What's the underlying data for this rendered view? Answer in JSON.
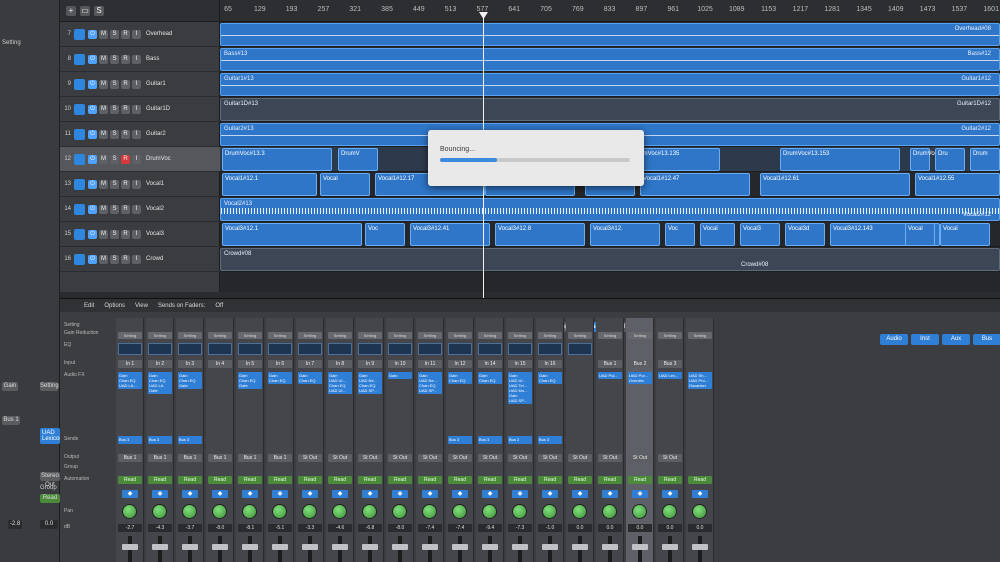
{
  "inspector": {
    "labels": [
      "Setting",
      "Gain",
      "Bus 1",
      "Stereo Out",
      "Group",
      "Read"
    ],
    "plugin": "UAD Lexicon",
    "values": [
      "-2.8",
      "0.0"
    ]
  },
  "toolbar": {
    "add": "+",
    "s": "S"
  },
  "tracks": [
    {
      "num": "7",
      "name": "Overhead"
    },
    {
      "num": "8",
      "name": "Bass"
    },
    {
      "num": "9",
      "name": "Guitar1"
    },
    {
      "num": "10",
      "name": "Guitar1D"
    },
    {
      "num": "11",
      "name": "Guitar2"
    },
    {
      "num": "12",
      "name": "DrumVoc"
    },
    {
      "num": "13",
      "name": "Vocal1"
    },
    {
      "num": "14",
      "name": "Vocal2"
    },
    {
      "num": "15",
      "name": "Vocal3"
    },
    {
      "num": "16",
      "name": "Crowd"
    }
  ],
  "track_buttons": [
    "M",
    "S",
    "R",
    "I"
  ],
  "ruler": [
    "65",
    "129",
    "193",
    "257",
    "321",
    "385",
    "449",
    "513",
    "577",
    "641",
    "705",
    "769",
    "833",
    "897",
    "961",
    "1025",
    "1089",
    "1153",
    "1217",
    "1281",
    "1345",
    "1409",
    "1473",
    "1537",
    "1601"
  ],
  "regions": {
    "overhead": "Overhead#08",
    "bass1": "Bass#13",
    "bass2": "Bass#12",
    "guitar1a": "Guitar1#13",
    "guitar1b": "Guitar1#12",
    "guitar1d_a": "Guitar1D#13",
    "guitar1d_b": "Guitar1D#12",
    "guitar2a": "Guitar2#13",
    "guitar2b": "Guitar2#12",
    "drumvoc": [
      "DrumVoc#13.3",
      "DrumV",
      "DrumVoc#13.135",
      "DrumVoc#13.153",
      "DrumVoc#13.158",
      "Dru",
      "Drum"
    ],
    "vocal1": [
      "Vocal1#12.1",
      "Vocal",
      "Vocal1#12.17",
      "Vocal1#12.21",
      "Vocal1#1",
      "Vocal1#12.47",
      "Vocal1#12.61",
      "Vocal1#12.55"
    ],
    "vocal2a": "Vocal2#13",
    "vocal2b": "Vocal2#12",
    "vocal3": [
      "Vocal3#12.1",
      "Voc",
      "Vocal3#12.41",
      "Vocal3#12.8",
      "Vocal3#12.",
      "Voc",
      "Vocal",
      "Vocal3",
      "Vocal3d",
      "Vocal3#12.143",
      "Vocal",
      "Vocal"
    ],
    "crowd": [
      "Crowd#08",
      "Crowd#08"
    ]
  },
  "bounce": {
    "label": "Bouncing...",
    "progress": 0.3
  },
  "mixer_bar": {
    "edit": "Edit",
    "options": "Options",
    "view": "View",
    "sends_on_faders": "Sends on Faders:",
    "off": "Off"
  },
  "mixer_tabs": [
    "Single",
    "Tracks",
    "All"
  ],
  "filter_tabs": [
    "Audio",
    "Inst",
    "Aux",
    "Bus"
  ],
  "row_labels": [
    "Setting",
    "Gain Reduction",
    "EQ",
    "Input",
    "Audio FX",
    "Sends",
    "Output",
    "Group",
    "Automation",
    "Pan",
    "dB"
  ],
  "strips": [
    {
      "setting": "Setting",
      "input": "In 1",
      "fx": "Gain\nChan EQ\nUAD LA...",
      "send": "Bus 3",
      "out": "Bus 1",
      "auto": "Read",
      "db": "-2.7"
    },
    {
      "setting": "Setting",
      "input": "In 2",
      "fx": "Gain\nChan EQ\nUAD LA\nGate",
      "send": "Bus 3",
      "out": "Bus 1",
      "auto": "Read",
      "db": "-4.3"
    },
    {
      "setting": "Setting",
      "input": "In 3",
      "fx": "Gain\nChan EQ\nGate",
      "send": "Bus 3",
      "out": "Bus 1",
      "auto": "Read",
      "db": "-3.7"
    },
    {
      "setting": "Setting",
      "input": "In 4",
      "fx": "",
      "send": "",
      "out": "Bus 1",
      "auto": "Read",
      "db": "-8.0"
    },
    {
      "setting": "Setting",
      "input": "In 5",
      "fx": "Gain\nChan EQ\nGate",
      "send": "",
      "out": "Bus 1",
      "auto": "Read",
      "db": "-8.1"
    },
    {
      "setting": "Setting",
      "input": "In 6",
      "fx": "Gain\nChan EQ",
      "send": "",
      "out": "Bus 1",
      "auto": "Read",
      "db": "-5.1"
    },
    {
      "setting": "Setting",
      "input": "In 7",
      "fx": "Gain\nChan EQ",
      "send": "",
      "out": "St Out",
      "auto": "Read",
      "db": "-3.3"
    },
    {
      "setting": "Setting",
      "input": "In 8",
      "fx": "Gain\nUAD Ul...\nChan EQ\nUAD Ul...",
      "send": "",
      "out": "St Out",
      "auto": "Read",
      "db": "-4.6"
    },
    {
      "setting": "Setting",
      "input": "In 9",
      "fx": "Gain\nUAD Ne...\nChan EQ\nUAD SP...",
      "send": "",
      "out": "St Out",
      "auto": "Read",
      "db": "-6.8"
    },
    {
      "setting": "Setting",
      "input": "In 10",
      "fx": "Gain",
      "send": "",
      "out": "St Out",
      "auto": "Read",
      "db": "-8.0"
    },
    {
      "setting": "Setting",
      "input": "In 11",
      "fx": "Gain\nUAD Ne...\nChan EQ\nUAD SP...",
      "send": "",
      "out": "St Out",
      "auto": "Read",
      "db": "-7.4"
    },
    {
      "setting": "Setting",
      "input": "In 12",
      "fx": "Gain\nChan EQ",
      "send": "Bus 3",
      "out": "St Out",
      "auto": "Read",
      "db": "-7.4"
    },
    {
      "setting": "Setting",
      "input": "In 14",
      "fx": "Gain\nChan EQ",
      "send": "Bus 3",
      "out": "St Out",
      "auto": "Read",
      "db": "-9.4"
    },
    {
      "setting": "Setting",
      "input": "In 15",
      "fx": "Gain\nUAD Ul...\nUAD Tel...\nUAD Mo...\nGain\nUAD SP...",
      "send": "Bus 2",
      "out": "St Out",
      "auto": "Read",
      "db": "-7.3"
    },
    {
      "setting": "Setting",
      "input": "In 16",
      "fx": "Gain\nChan EQ",
      "send": "Bus 3",
      "out": "St Out",
      "auto": "Read",
      "db": "-1.0"
    },
    {
      "setting": "Setting",
      "input": "",
      "fx": "",
      "send": "",
      "out": "St Out",
      "auto": "Read",
      "db": "0.0"
    },
    {
      "setting": "Setting",
      "input": "Bus 1",
      "fx": "UAD Pul...",
      "send": "",
      "out": "St Out",
      "auto": "Read",
      "db": "0.0"
    },
    {
      "setting": "Setting",
      "input": "Bus 2",
      "fx": "UAD Pur...\nOverdriv",
      "send": "",
      "out": "St Out",
      "auto": "Read",
      "db": "0.0"
    },
    {
      "setting": "Setting",
      "input": "Bus 3",
      "fx": "UAD Lex...",
      "send": "",
      "out": "St Out",
      "auto": "Read",
      "db": "0.0"
    },
    {
      "setting": "Setting",
      "input": "",
      "fx": "UAD Sh...\nUAD Pro...\nOscarizer",
      "send": "",
      "out": "",
      "auto": "Read",
      "db": "0.0"
    }
  ]
}
